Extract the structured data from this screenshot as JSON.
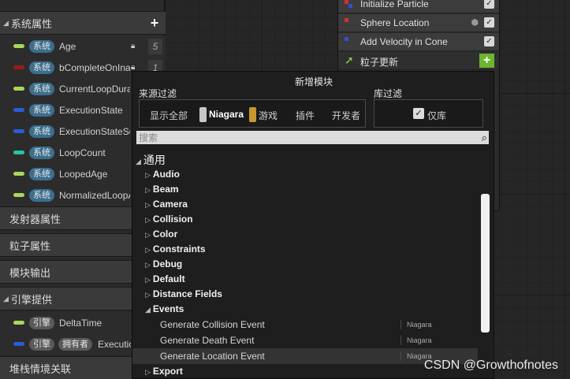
{
  "left_panel": {
    "system_props_label": "系统属性",
    "params": [
      {
        "badge": "系统",
        "name": "Age",
        "value": "5",
        "color": "#a8d85a"
      },
      {
        "badge": "系统",
        "name": "bCompleteOnInactive",
        "value": "1",
        "color": "#9b1b1b"
      },
      {
        "badge": "系统",
        "name": "CurrentLoopDuration",
        "value": "",
        "color": "#a8d85a"
      },
      {
        "badge": "系统",
        "name": "ExecutionState",
        "value": "",
        "color": "#2a5bd8"
      },
      {
        "badge": "系统",
        "name": "ExecutionStateSource",
        "value": "",
        "color": "#2a5bd8"
      },
      {
        "badge": "系统",
        "name": "LoopCount",
        "value": "",
        "color": "#28c2a0"
      },
      {
        "badge": "系统",
        "name": "LoopedAge",
        "value": "",
        "color": "#a8d85a"
      },
      {
        "badge": "系统",
        "name": "NormalizedLoopAge",
        "value": "",
        "color": "#a8d85a"
      }
    ],
    "sections": {
      "emitter": "发射器属性",
      "particle": "粒子属性",
      "module_out": "模块输出",
      "engine": "引擎提供",
      "stack_ctx": "堆栈情境关联"
    },
    "engine_params": [
      {
        "badges": [
          "引擎"
        ],
        "name": "DeltaTime",
        "color": "#a8d85a"
      },
      {
        "badges": [
          "引擎",
          "拥有者"
        ],
        "name": "ExecutionState",
        "color": "#2a5bd8"
      }
    ]
  },
  "node": {
    "items": [
      "Initialize Particle",
      "Sphere Location",
      "Add Velocity in Cone"
    ],
    "update_label": "粒子更新"
  },
  "popup": {
    "title": "新增模块",
    "source_filter_label": "来源过滤",
    "library_filter_label": "库过滤",
    "source_options": [
      "显示全部",
      "Niagara",
      "游戏",
      "插件",
      "开发者"
    ],
    "library_option": "仅库",
    "search_placeholder": "搜索",
    "root_category": "通用",
    "categories_before": [
      "Audio",
      "Beam",
      "Camera",
      "Collision",
      "Color",
      "Constraints",
      "Debug",
      "Default",
      "Distance Fields"
    ],
    "open_category": "Events",
    "event_items": [
      {
        "label": "Generate Collision Event",
        "source": "Niagara"
      },
      {
        "label": "Generate Death Event",
        "source": "Niagara"
      },
      {
        "label": "Generate Location Event",
        "source": "Niagara"
      }
    ],
    "categories_after": [
      "Export"
    ]
  },
  "watermark": "CSDN @Growthofnotes"
}
